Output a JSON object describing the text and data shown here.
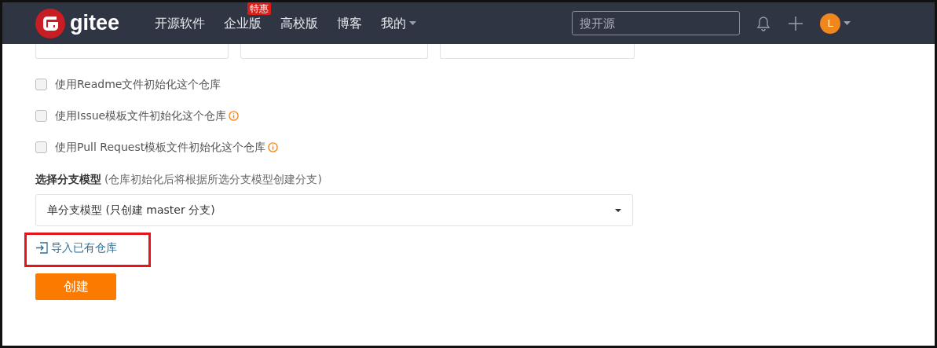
{
  "navbar": {
    "logo_text": "gitee",
    "links": [
      {
        "label": "开源软件",
        "dropdown": false
      },
      {
        "label": "企业版",
        "badge": "特惠",
        "dropdown": false
      },
      {
        "label": "高校版",
        "dropdown": false
      },
      {
        "label": "博客",
        "dropdown": false
      },
      {
        "label": "我的",
        "dropdown": true
      }
    ],
    "search": {
      "placeholder": "搜开源"
    },
    "avatar_letter": "L"
  },
  "options": [
    {
      "label": "使用Readme文件初始化这个仓库",
      "checked": false,
      "info": false
    },
    {
      "label": "使用Issue模板文件初始化这个仓库",
      "checked": false,
      "info": true
    },
    {
      "label": "使用Pull Request模板文件初始化这个仓库",
      "checked": false,
      "info": true
    }
  ],
  "branch_model": {
    "label": "选择分支模型",
    "hint": "(仓库初始化后将根据所选分支模型创建分支)",
    "value": "单分支模型 (只创建 master 分支)"
  },
  "import_link": {
    "label": "导入已有仓库",
    "highlighted": true
  },
  "submit_button": "创建"
}
